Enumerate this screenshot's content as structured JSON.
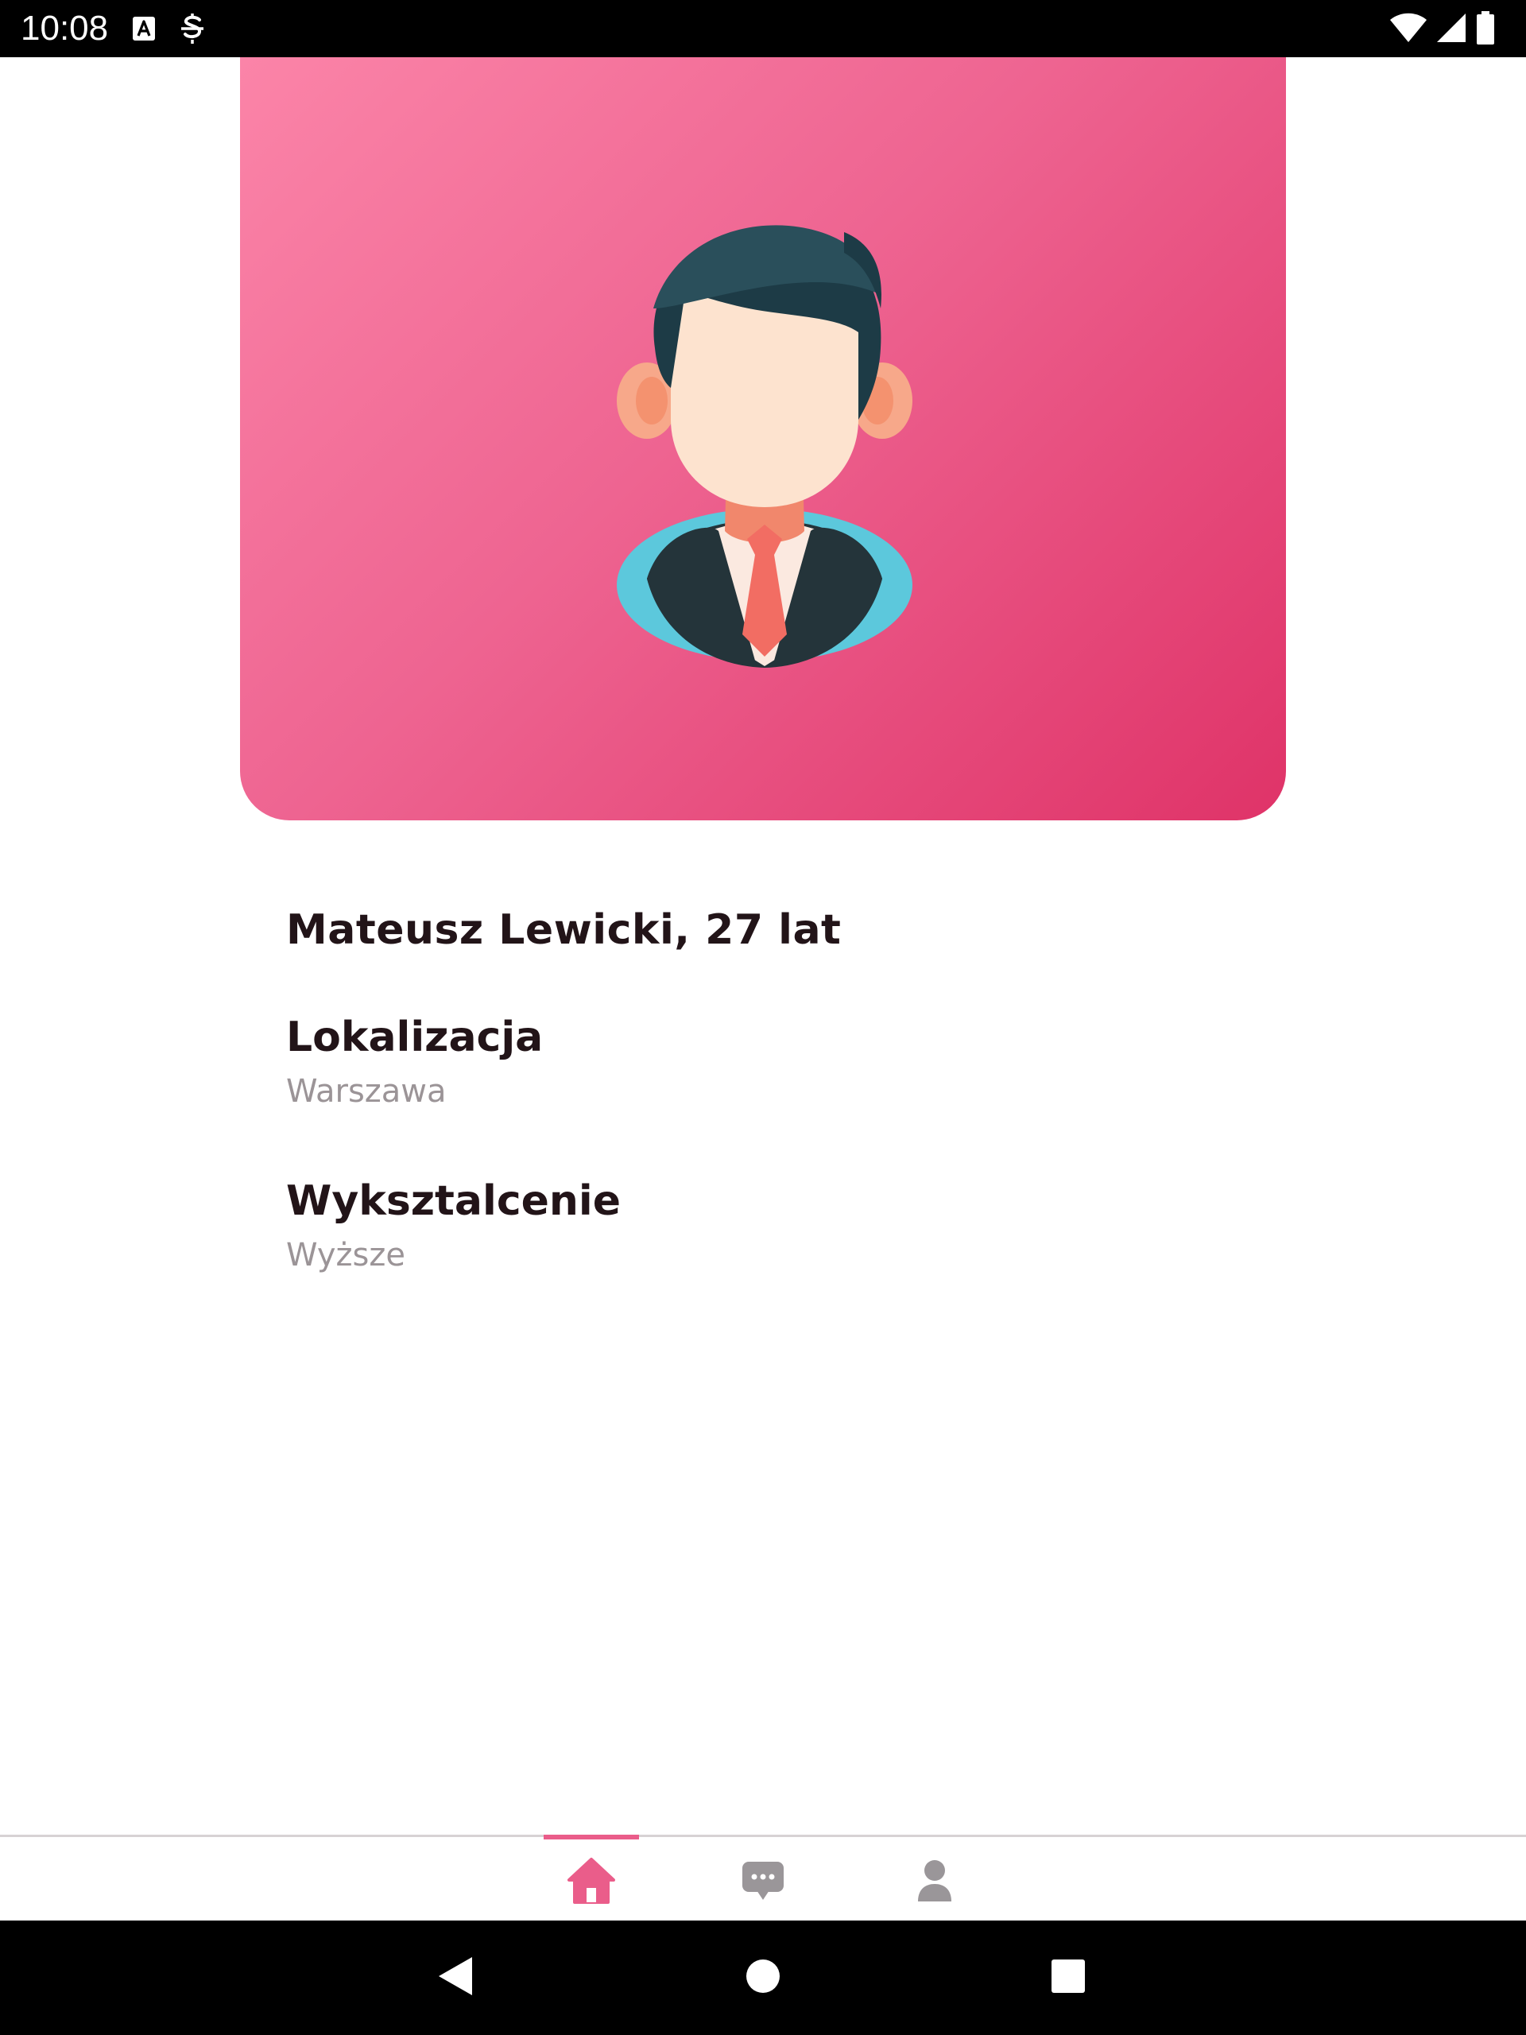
{
  "status_bar": {
    "time": "10:08",
    "left_icons": [
      "text-a-icon",
      "sync-s-icon"
    ],
    "right_icons": [
      "wifi-icon",
      "cell-signal-icon",
      "battery-icon"
    ]
  },
  "profile": {
    "avatar_icon": "man-avatar-icon",
    "name_age": "Mateusz Lewicki, 27 lat",
    "sections": [
      {
        "title": "Lokalizacja",
        "value": "Warszawa"
      },
      {
        "title": "Wyksztalcenie",
        "value": "Wyższe"
      }
    ]
  },
  "bottom_nav": {
    "items": [
      {
        "icon": "home-icon",
        "active": true
      },
      {
        "icon": "chat-icon",
        "active": false
      },
      {
        "icon": "person-icon",
        "active": false
      }
    ]
  },
  "system_nav": {
    "buttons": [
      "back-icon",
      "home-circle-icon",
      "recents-icon"
    ]
  },
  "colors": {
    "accent": "#ea5d8a",
    "hero_start": "#fb84a8",
    "hero_end": "#df3368",
    "title_text": "#221418",
    "secondary_text": "#9b9497",
    "inactive_icon": "#9a9699"
  }
}
